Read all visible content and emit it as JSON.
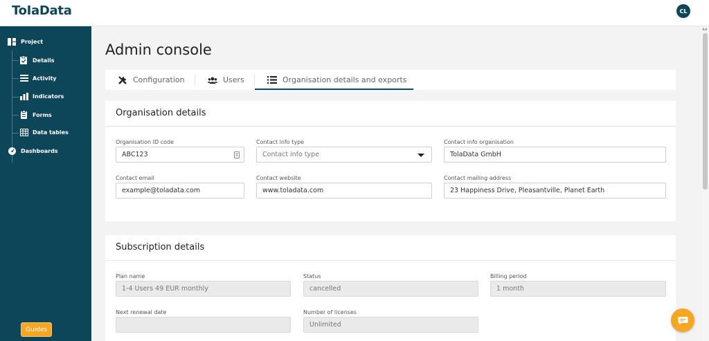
{
  "app": {
    "logo": "ToIaData",
    "avatar_initials": "CL"
  },
  "sidebar": {
    "items": [
      {
        "label": "Project",
        "icon": "dashboard-icon"
      },
      {
        "label": "Details",
        "icon": "clipboard-check-icon"
      },
      {
        "label": "Activity",
        "icon": "list-icon"
      },
      {
        "label": "Indicators",
        "icon": "bar-chart-icon"
      },
      {
        "label": "Forms",
        "icon": "form-icon"
      },
      {
        "label": "Data tables",
        "icon": "table-icon"
      },
      {
        "label": "Dashboards",
        "icon": "gauge-icon"
      }
    ],
    "guides_label": "Guides"
  },
  "page": {
    "title": "Admin console"
  },
  "tabs": [
    {
      "label": "Configuration",
      "icon": "tools-icon"
    },
    {
      "label": "Users",
      "icon": "users-icon"
    },
    {
      "label": "Organisation details and exports",
      "icon": "list-icon",
      "active": true
    }
  ],
  "org_details": {
    "title": "Organisation details",
    "org_id": {
      "label": "Organisation ID code",
      "value": "ABC123"
    },
    "contact_type": {
      "label": "Contact info type",
      "placeholder": "Contact info type"
    },
    "contact_org": {
      "label": "Contact info organisation",
      "value": "TolaData GmbH"
    },
    "contact_email": {
      "label": "Contact email",
      "value": "example@toladata.com"
    },
    "contact_website": {
      "label": "Contact website",
      "value": "www.toladata.com"
    },
    "contact_address": {
      "label": "Contact mailing address",
      "value": "23 Happiness Drive, Pleasantville, Planet Earth"
    }
  },
  "subscription": {
    "title": "Subscription details",
    "plan_name": {
      "label": "Plan name",
      "value": "1-4 Users 49 EUR monthly"
    },
    "status": {
      "label": "Status",
      "value": "cancelled"
    },
    "billing_period": {
      "label": "Billing period",
      "value": "1 month"
    },
    "next_renewal": {
      "label": "Next renewal date",
      "value": ""
    },
    "licenses": {
      "label": "Number of licenses",
      "value": "Unlimited"
    }
  },
  "colors": {
    "brand": "#0d4559",
    "accent": "#f5a623"
  }
}
